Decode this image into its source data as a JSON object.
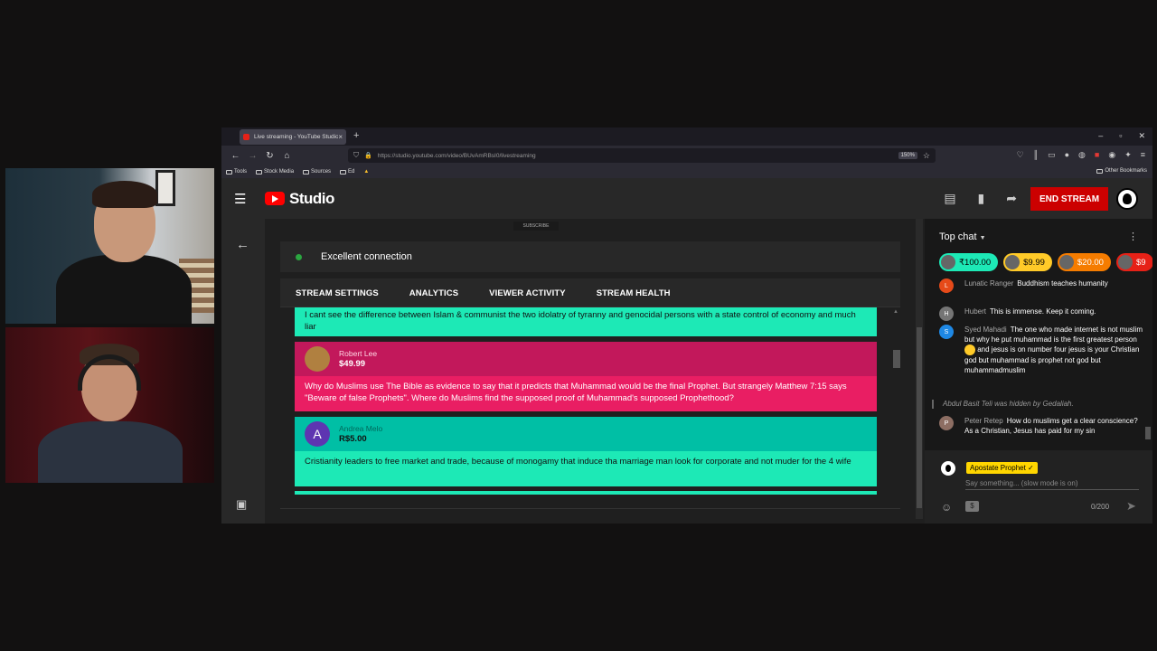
{
  "browser": {
    "tab_title": "Live streaming - YouTube Studio",
    "url": "https://studio.youtube.com/video/BUvAmRBsI0/livestreaming",
    "zoom": "150%",
    "bookmarks": [
      "Tools",
      "Stock Media",
      "Sources",
      "Ed"
    ],
    "other_bookmarks": "Other Bookmarks"
  },
  "studio": {
    "brand": "Studio",
    "end_stream": "END STREAM",
    "subscribe_label": "SUBSCRIBE",
    "connection_status": "Excellent connection",
    "tabs": [
      "STREAM SETTINGS",
      "ANALYTICS",
      "VIEWER ACTIVITY",
      "STREAM HEALTH"
    ],
    "superchats": [
      {
        "text": "I cant see the difference between Islam & communist the two idolatry of tyranny and genocidal persons with a state control of economy and much liar",
        "color": "#1de9b6"
      },
      {
        "name": "Robert Lee",
        "amount": "$49.99",
        "text": "Why do Muslims use The Bible as evidence to say that it predicts that Muhammad would be the final Prophet. But strangely Matthew 7:15 says \"Beware of false Prophets\". Where do Muslims find the supposed proof of Muhammad's supposed Prophethood?",
        "color": "#e91e63"
      },
      {
        "name": "Andrea Melo",
        "initial": "A",
        "amount": "R$5.00",
        "text": "Cristianity leaders to free market and trade, because of monogamy that induce tha marriage man look for corporate and not muder for the 4 wife",
        "color": "#1de9b6"
      }
    ]
  },
  "chat": {
    "title": "Top chat",
    "tickers": [
      {
        "amount": "₹100.00",
        "color": "#1de9b6"
      },
      {
        "amount": "$9.99",
        "color": "#ffca28"
      },
      {
        "amount": "$20.00",
        "color": "#f57c00"
      },
      {
        "amount": "$9",
        "color": "#e62117"
      }
    ],
    "messages": [
      {
        "author": "Lunatic Ranger",
        "initial": "L",
        "text": "Buddhism teaches humanity",
        "avatar_color": "#e64a19"
      },
      {
        "author": "Hubert",
        "initial": "H",
        "text": "This is immense. Keep it coming.",
        "avatar_color": "#757575"
      },
      {
        "author": "Syed Mahadi",
        "initial": "S",
        "text_a": "The one who made internet is not muslim but why he put muhammad is the first greatest person",
        "text_b": "and jesus is on number four jesus is your Christian god but muhammad is prophet not god but muhammadmuslim",
        "avatar_color": "#1e88e5"
      },
      {
        "author": "Peter Retep",
        "initial": "P",
        "text": "How do muslims get a clear conscience? As a Christian, Jesus has paid for my sin",
        "avatar_color": "#8d6e63"
      }
    ],
    "hidden_note": {
      "name": "Abdul Basit Teli",
      "text": "was hidden by",
      "by": "Gedaliah."
    },
    "user_badge": "Apostate Prophet ✓",
    "input_placeholder": "Say something... (slow mode is on)",
    "char_count": "0/200"
  }
}
